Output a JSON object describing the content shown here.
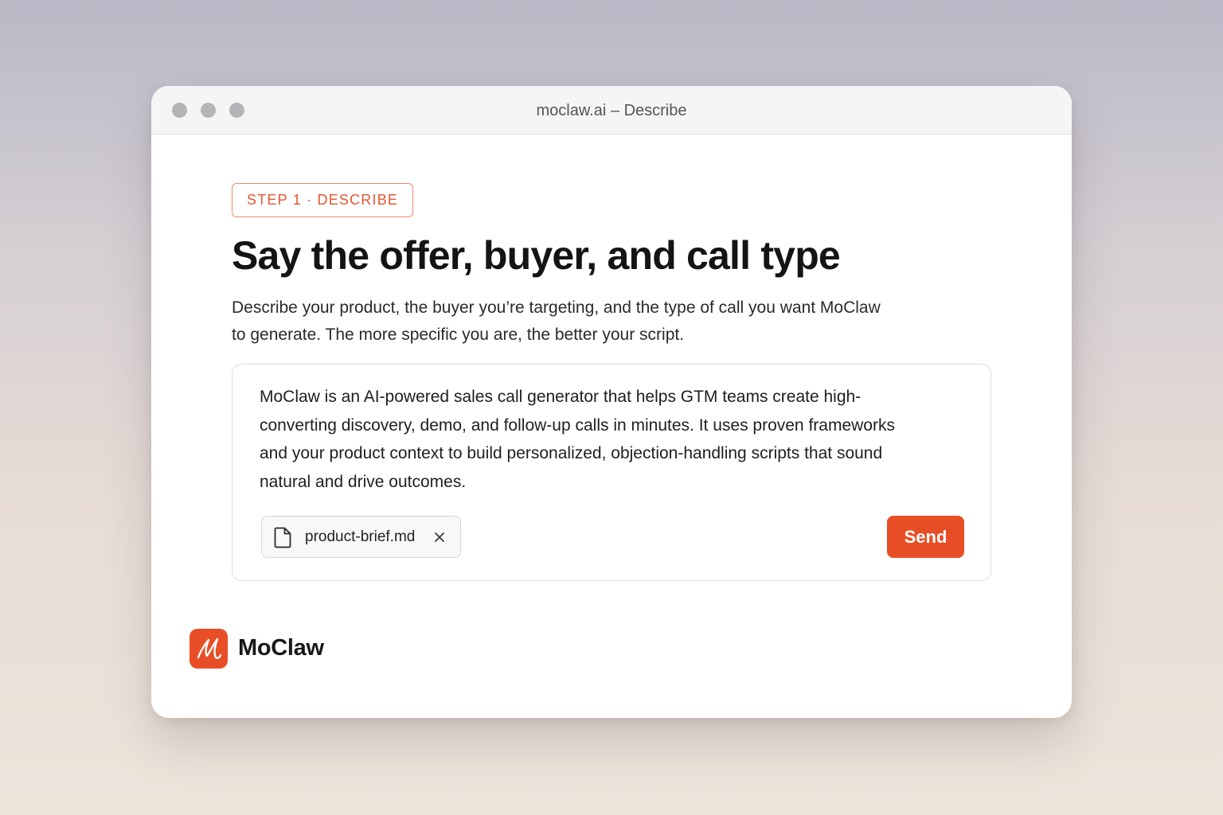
{
  "window": {
    "title": "moclaw.ai – Describe"
  },
  "step": {
    "badge": "STEP 1 · DESCRIBE"
  },
  "header": {
    "title": "Say the offer, buyer, and call type",
    "description": "Describe your product, the buyer you’re targeting, and the type of call you want MoClaw to generate. The more specific you are, the better your script."
  },
  "composer": {
    "text": "MoClaw is an AI-powered sales call generator that helps GTM teams create high-converting discovery, demo, and follow-up calls in minutes. It uses proven frameworks and your product context to build personalized, objection-handling scripts that sound natural and drive outcomes.",
    "attachment": {
      "file_name": "product-brief.md",
      "icon": "file-icon",
      "remove_icon": "close-icon"
    },
    "send_label": "Send"
  },
  "brand": {
    "name": "MoClaw",
    "logo_icon": "moclaw-logo-icon"
  },
  "colors": {
    "accent": "#e84e26",
    "badge_border": "#ef8a6d",
    "text_primary": "#141416"
  }
}
